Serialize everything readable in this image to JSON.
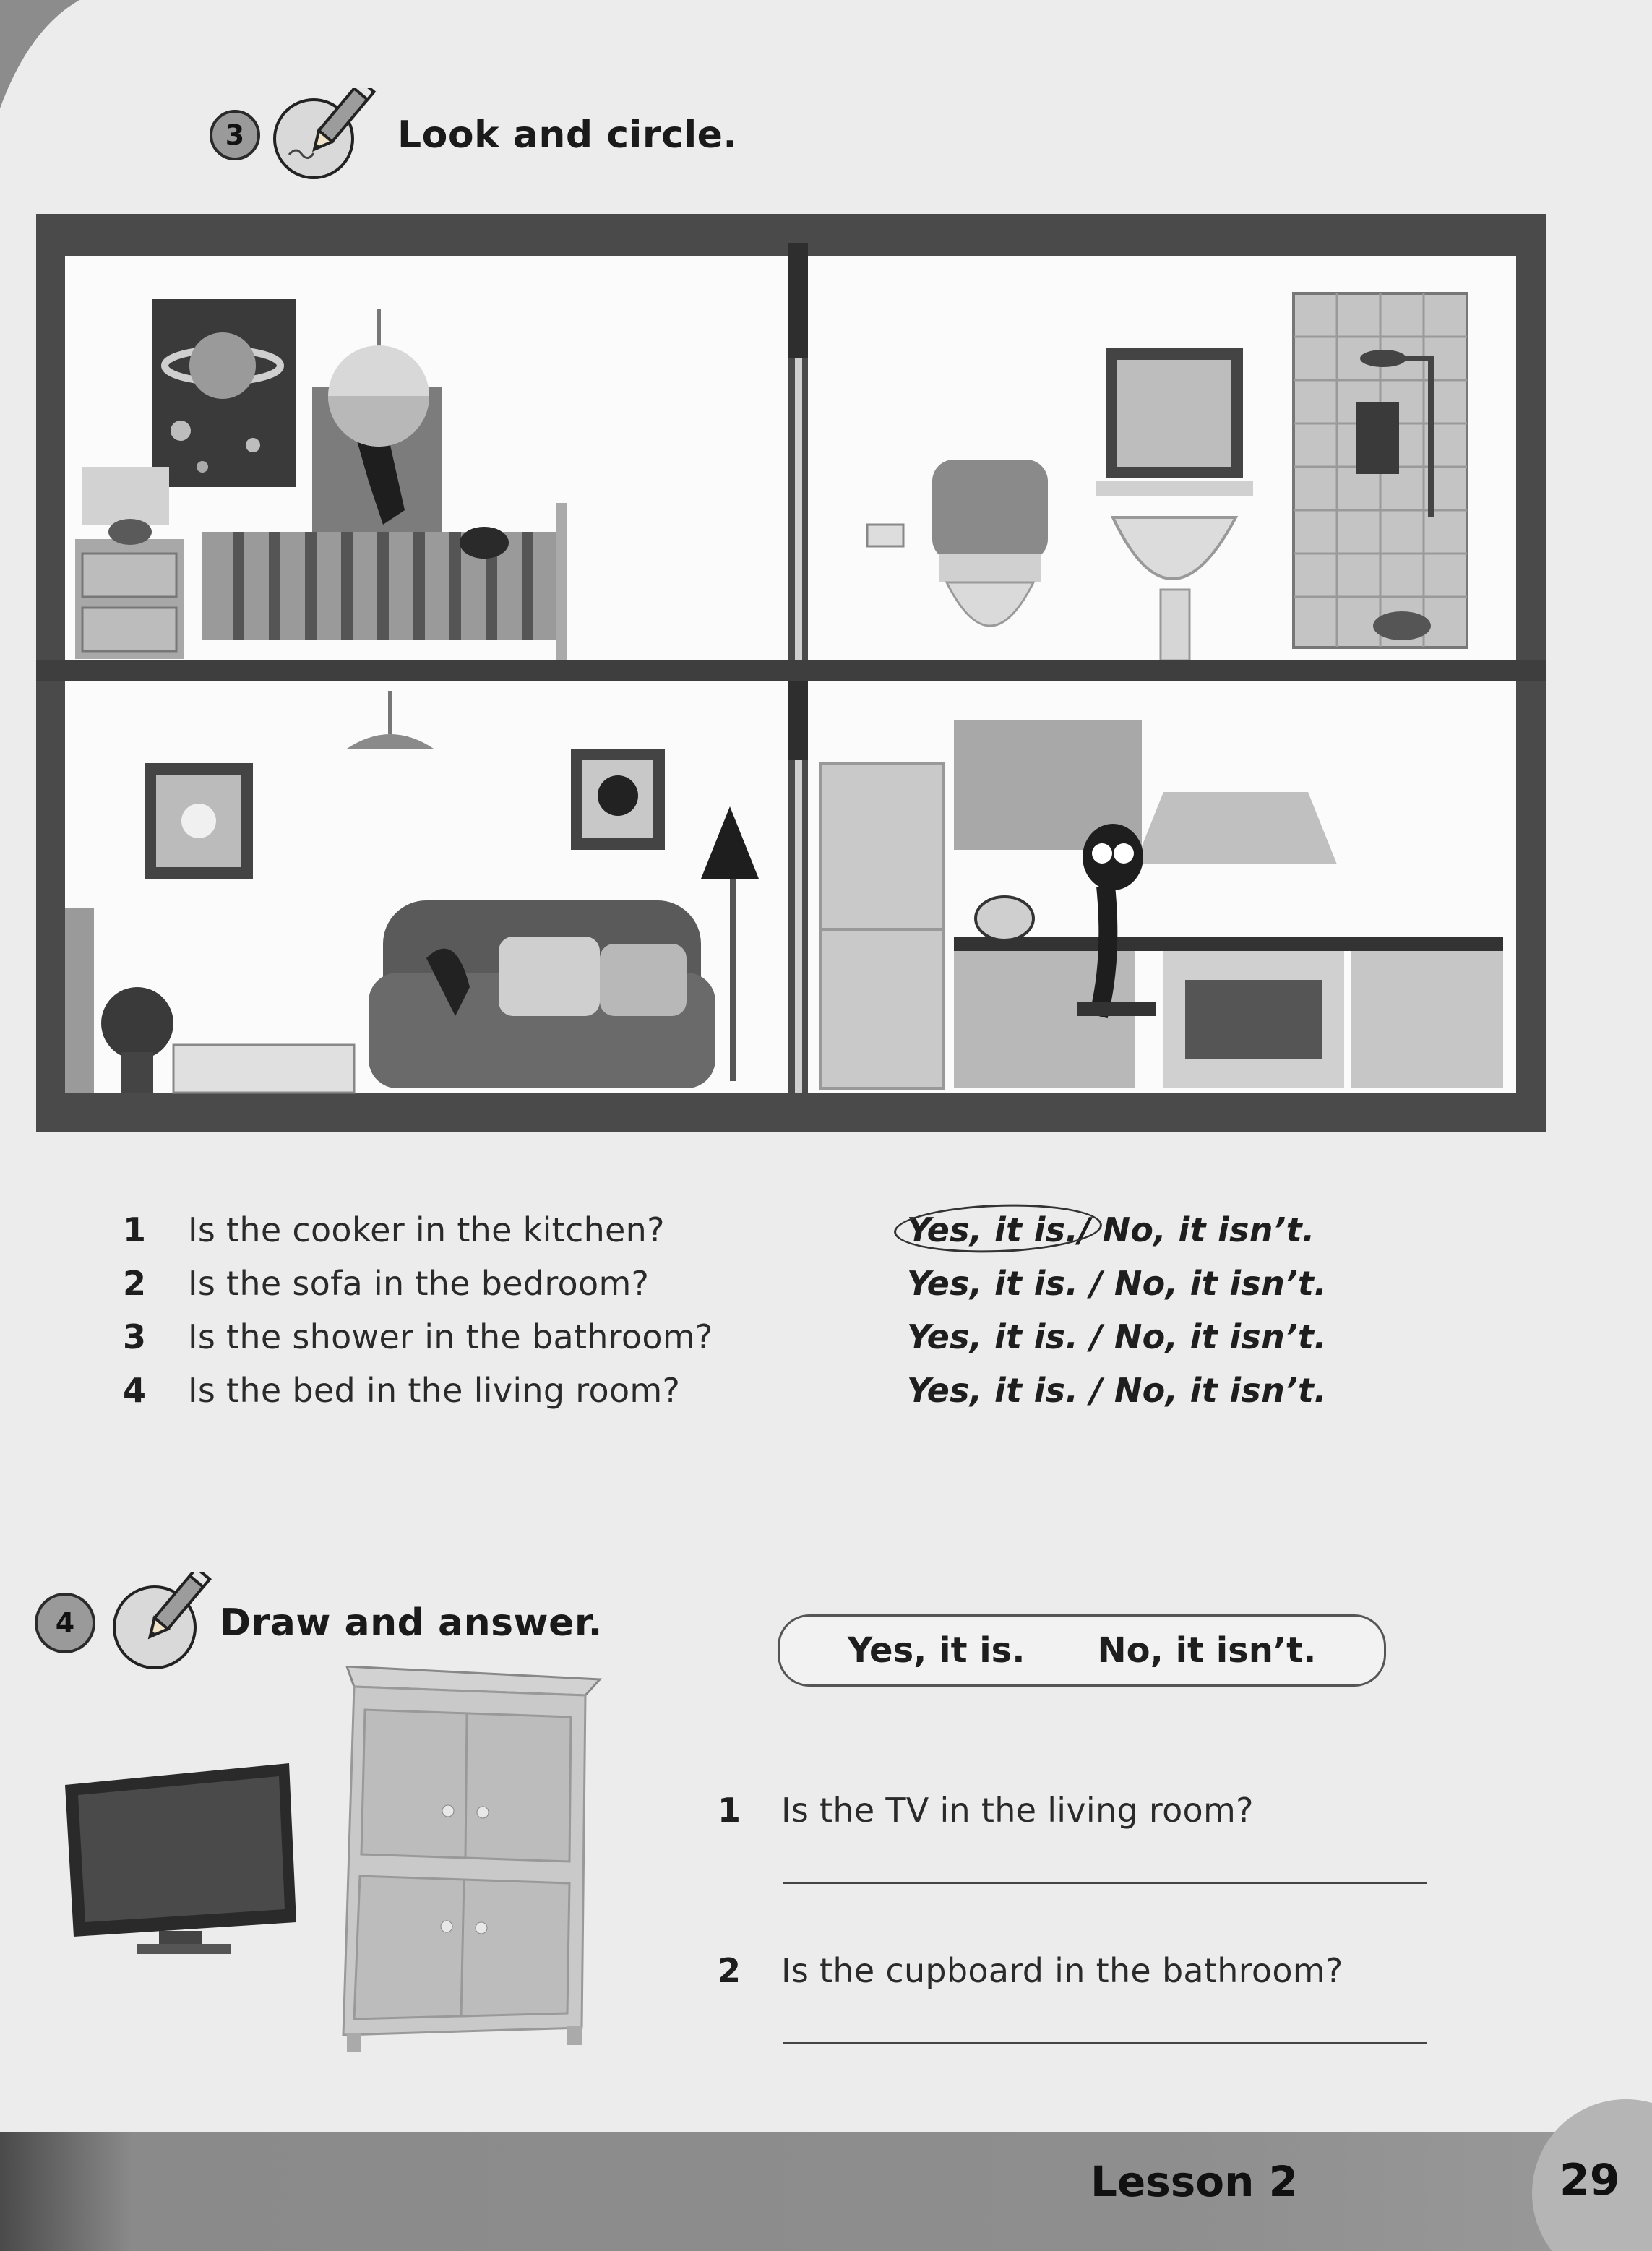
{
  "exercise3": {
    "number": "3",
    "title": "Look and circle.",
    "questions": [
      {
        "number": "1",
        "text": "Is the cooker in the kitchen?",
        "answer_yes": "Yes, it is.",
        "separator": "/",
        "answer_no": "No, it isn’t.",
        "circled": "yes"
      },
      {
        "number": "2",
        "text": "Is the sofa in the bedroom?",
        "answer": "Yes, it is. / No, it isn’t."
      },
      {
        "number": "3",
        "text": "Is the shower in the bathroom?",
        "answer": "Yes, it is. / No, it isn’t."
      },
      {
        "number": "4",
        "text": "Is the bed in the living room?",
        "answer": "Yes, it is. / No, it isn’t."
      }
    ]
  },
  "exercise4": {
    "number": "4",
    "title": "Draw and answer.",
    "answer_options": [
      "Yes, it is.",
      "No, it isn’t."
    ],
    "questions": [
      {
        "number": "1",
        "text": "Is the TV in the living room?"
      },
      {
        "number": "2",
        "text": "Is the cupboard in the bathroom?"
      }
    ]
  },
  "footer": {
    "lesson": "Lesson 2",
    "page_number": "29"
  },
  "illustration": {
    "rooms": [
      "bedroom",
      "bathroom",
      "living room",
      "kitchen"
    ],
    "icons": [
      "pencil-icon",
      "pencil-icon"
    ]
  }
}
